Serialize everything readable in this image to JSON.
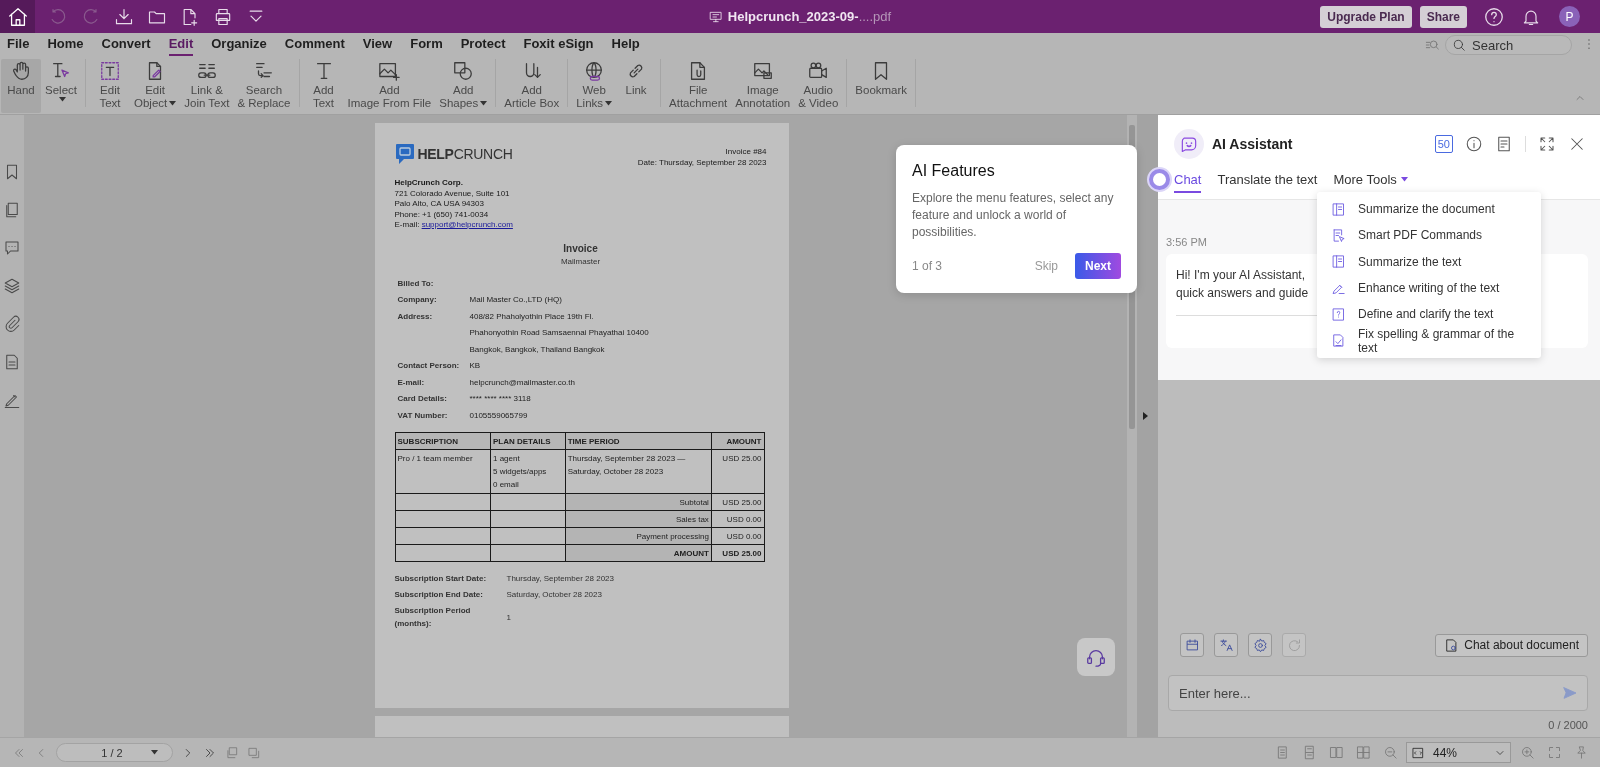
{
  "title_bar": {
    "file_name": "Helpcrunch_2023-09-",
    "file_name_tail": "....pdf",
    "buttons": [
      "Upgrade Plan",
      "Share"
    ],
    "avatar": "P"
  },
  "menu": [
    {
      "label": "File",
      "selected": false
    },
    {
      "label": "Home",
      "selected": false
    },
    {
      "label": "Convert",
      "selected": false
    },
    {
      "label": "Edit",
      "selected": true
    },
    {
      "label": "Organize",
      "selected": false
    },
    {
      "label": "Comment",
      "selected": false
    },
    {
      "label": "View",
      "selected": false
    },
    {
      "label": "Form",
      "selected": false
    },
    {
      "label": "Protect",
      "selected": false
    },
    {
      "label": "Foxit eSign",
      "selected": false
    },
    {
      "label": "Help",
      "selected": false
    }
  ],
  "search": {
    "placeholder": "Search"
  },
  "ribbon": {
    "groups": [
      [
        {
          "lines": [
            "Hand"
          ],
          "selected": true,
          "has_menu": false
        },
        {
          "lines": [
            "Select"
          ],
          "selected": false,
          "has_menu": true
        }
      ],
      [
        {
          "lines": [
            "Edit",
            "Text"
          ],
          "selected": false,
          "has_menu": false
        },
        {
          "lines": [
            "Edit",
            "Object"
          ],
          "selected": false,
          "has_menu": true
        },
        {
          "lines": [
            "Link &",
            "Join Text"
          ],
          "selected": false,
          "has_menu": false
        },
        {
          "lines": [
            "Search",
            "& Replace"
          ],
          "selected": false,
          "has_menu": false
        }
      ],
      [
        {
          "lines": [
            "Add",
            "Text"
          ],
          "selected": false,
          "has_menu": false
        },
        {
          "lines": [
            "Add",
            "Image From File"
          ],
          "selected": false,
          "has_menu": false
        },
        {
          "lines": [
            "Add",
            "Shapes"
          ],
          "selected": false,
          "has_menu": true
        }
      ],
      [
        {
          "lines": [
            "Add",
            "Article Box"
          ],
          "selected": false,
          "has_menu": false
        }
      ],
      [
        {
          "lines": [
            "Web",
            "Links"
          ],
          "selected": false,
          "has_menu": true
        },
        {
          "lines": [
            "Link"
          ],
          "selected": false,
          "has_menu": false
        }
      ],
      [
        {
          "lines": [
            "File",
            "Attachment"
          ],
          "selected": false,
          "has_menu": false
        },
        {
          "lines": [
            "Image",
            "Annotation"
          ],
          "selected": false,
          "has_menu": false
        },
        {
          "lines": [
            "Audio",
            "& Video"
          ],
          "selected": false,
          "has_menu": false
        }
      ],
      [
        {
          "lines": [
            "Bookmark"
          ],
          "selected": false,
          "has_menu": false
        }
      ]
    ]
  },
  "document": {
    "logo": "**HELP**CRUNCH",
    "invoice_no": "Invoice #84",
    "date": "Date: Thursday, September 28 2023",
    "company_name": "HelpCrunch Corp.",
    "company_lines": [
      "721 Colorado Avenue, Suite 101",
      "Palo Alto, CA USA 94303",
      "Phone: +1 (650) 741-0034"
    ],
    "email_label": "E-mail:",
    "email": "support@helpcrunch.com",
    "title": "Invoice",
    "subtitle": "Mailmaster",
    "billed_to": "Billed To:",
    "fields": [
      {
        "label": "Company:",
        "values": [
          "Mail Master Co.,LTD (HQ)"
        ]
      },
      {
        "label": "Address:",
        "values": [
          "408/82 Phaholyothin Place 19th Fl.",
          "Phahonyothin Road Samsaennai Phayathai 10400",
          "Bangkok, Bangkok, Thailand Bangkok"
        ]
      },
      {
        "label": "Contact Person:",
        "values": [
          "KB"
        ]
      },
      {
        "label": "E-mail:",
        "values": [
          "helpcrunch@mailmaster.co.th"
        ]
      },
      {
        "label": "Card Details:",
        "values": [
          "**** **** **** 3118"
        ]
      },
      {
        "label": "VAT Number:",
        "values": [
          "0105559065799"
        ]
      }
    ],
    "table": {
      "columns": [
        "SUBSCRIPTION",
        "PLAN DETAILS",
        "TIME PERIOD",
        "AMOUNT"
      ],
      "rows": [
        {
          "cells": [
            [
              "Pro / 1 team member"
            ],
            [
              "1 agent",
              "5 widgets/apps",
              "0 email"
            ],
            [
              "Thursday, September 28 2023 —",
              "Saturday, October 28 2023"
            ],
            [
              "USD 25.00"
            ]
          ]
        }
      ],
      "totals": [
        {
          "label": "Subtotal",
          "value": "USD 25.00",
          "bold": false
        },
        {
          "label": "Sales tax",
          "value": "USD 0.00",
          "bold": false
        },
        {
          "label": "Payment processing",
          "value": "USD 0.00",
          "bold": false
        },
        {
          "label": "AMOUNT",
          "value": "USD 25.00",
          "bold": true
        }
      ]
    },
    "footer_fields": [
      {
        "label": "Subscription Start Date:",
        "value": "Thursday, September 28 2023"
      },
      {
        "label": "Subscription End Date:",
        "value": "Saturday, October 28 2023"
      },
      {
        "label": "Subscription Period (months):",
        "value": "1"
      }
    ]
  },
  "ai_features": {
    "title": "AI Features",
    "body": "Explore the menu features, select any feature and unlock a world of possibilities.",
    "step": "1 of 3",
    "skip": "Skip",
    "next": "Next"
  },
  "assistant": {
    "title": "AI Assistant",
    "credits": "50",
    "tabs": [
      {
        "label": "Chat",
        "selected": true,
        "has_menu": false
      },
      {
        "label": "Translate the text",
        "selected": false,
        "has_menu": false
      },
      {
        "label": "More Tools",
        "selected": false,
        "has_menu": true
      }
    ],
    "time": "3:56 PM",
    "message_lines": [
      "Hi! I'm your AI Assistant,",
      "quick answers and guide"
    ],
    "more_tools_menu": [
      "Summarize the document",
      "Smart PDF Commands",
      "Summarize the text",
      "Enhance writing of the text",
      "Define and clarify the text",
      "Fix spelling & grammar of the text"
    ],
    "chat_about": "Chat about document",
    "input": {
      "placeholder": "Enter here..."
    },
    "counter": "0 / 2000"
  },
  "status_bar": {
    "page": "1 / 2",
    "zoom": "44%"
  }
}
